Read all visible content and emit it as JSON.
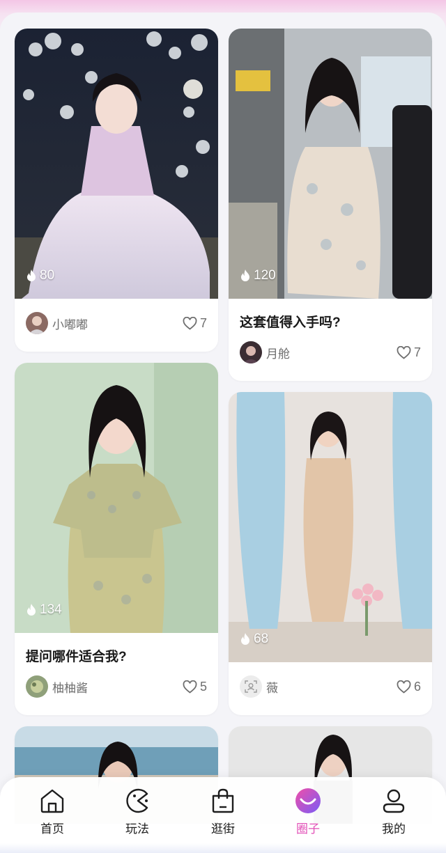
{
  "colors": {
    "accent": "#e24fb7",
    "background": "#f4f4f8",
    "card": "#ffffff"
  },
  "feed": [
    {
      "heat": "80",
      "title": "",
      "author": "小嘟嘟",
      "likes": "7"
    },
    {
      "heat": "120",
      "title": "这套值得入手吗?",
      "author": "月舱",
      "likes": "7"
    },
    {
      "heat": "134",
      "title": "提问哪件适合我?",
      "author": "柚柚酱",
      "likes": "5"
    },
    {
      "heat": "68",
      "title": "",
      "author": "薇",
      "likes": "6"
    }
  ],
  "tabbar": {
    "items": [
      {
        "label": "首页",
        "icon": "home-icon"
      },
      {
        "label": "玩法",
        "icon": "pacman-icon"
      },
      {
        "label": "逛街",
        "icon": "shopping-bag-icon"
      },
      {
        "label": "圈子",
        "icon": "circle-smile-icon"
      },
      {
        "label": "我的",
        "icon": "user-icon"
      }
    ],
    "active": "圈子"
  }
}
